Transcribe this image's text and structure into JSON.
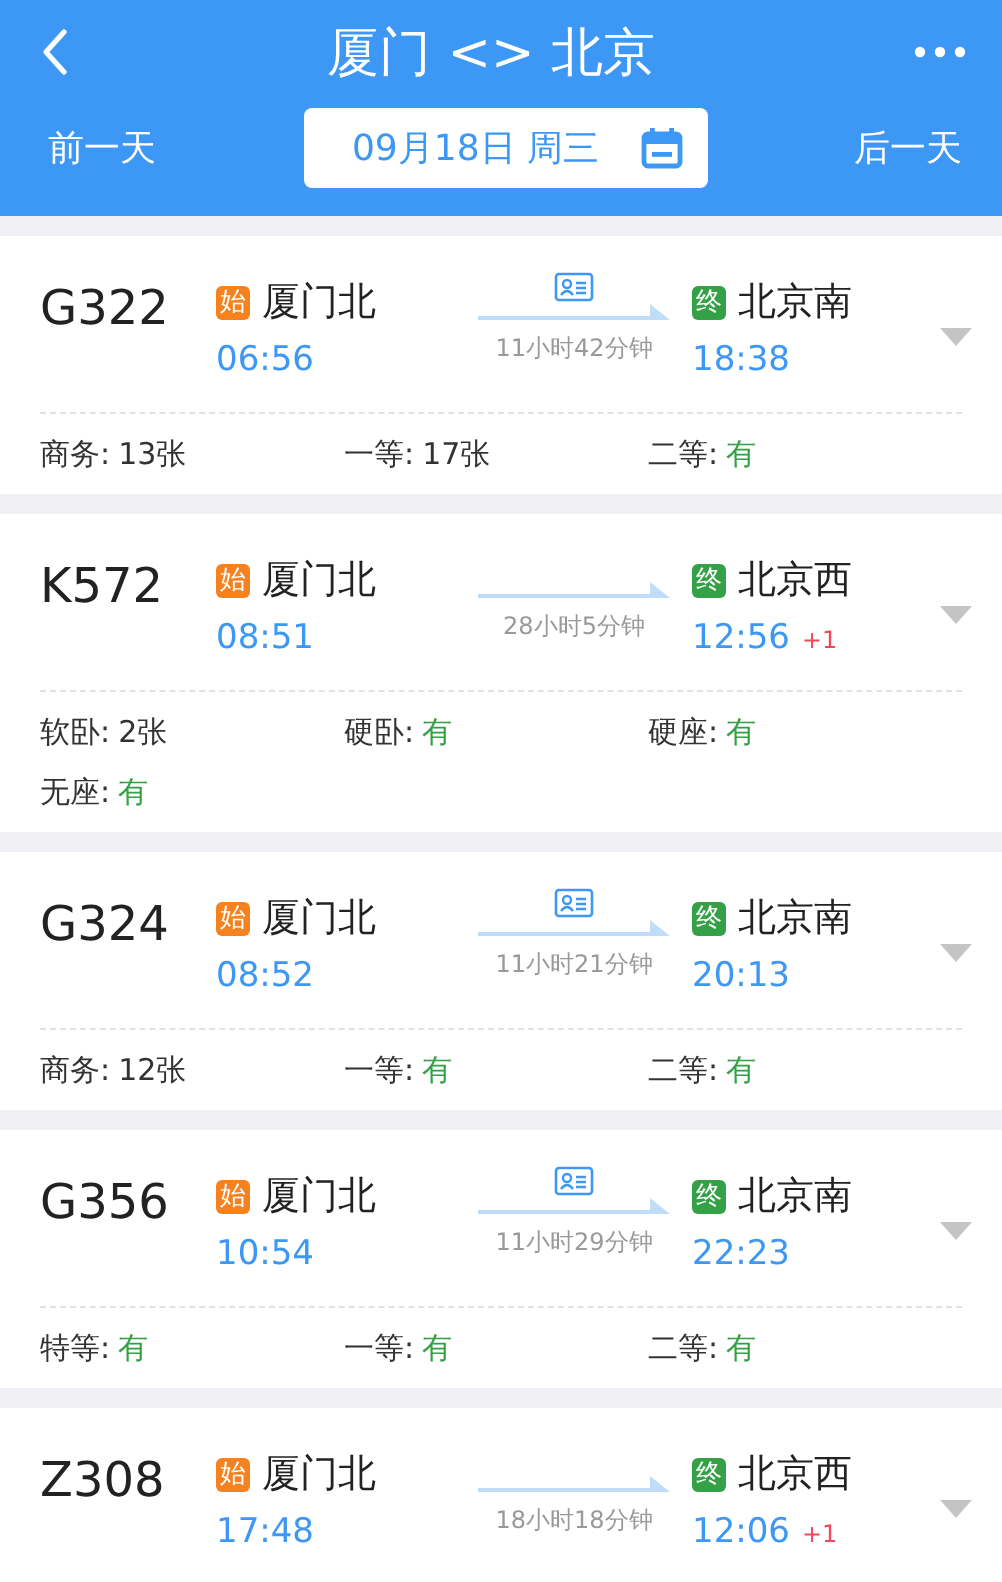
{
  "header": {
    "title": "厦门 <> 北京",
    "prev_day": "前一天",
    "date": "09月18日 周三",
    "next_day": "后一天"
  },
  "trains": [
    {
      "number": "G322",
      "from_badge": "始",
      "from": "厦门北",
      "depart": "06:56",
      "id_card": true,
      "duration": "11小时42分钟",
      "to_badge": "终",
      "to": "北京南",
      "arrive": "18:38",
      "seats": [
        {
          "label": "商务:",
          "value": "13张",
          "available": false
        },
        {
          "label": "一等:",
          "value": "17张",
          "available": false
        },
        {
          "label": "二等:",
          "value": "有",
          "available": true
        }
      ]
    },
    {
      "number": "K572",
      "from_badge": "始",
      "from": "厦门北",
      "depart": "08:51",
      "id_card": false,
      "duration": "28小时5分钟",
      "to_badge": "终",
      "to": "北京西",
      "arrive": "12:56",
      "day_offset": "+1",
      "seats": [
        {
          "label": "软卧:",
          "value": "2张",
          "available": false
        },
        {
          "label": "硬卧:",
          "value": "有",
          "available": true
        },
        {
          "label": "硬座:",
          "value": "有",
          "available": true
        },
        {
          "label": "无座:",
          "value": "有",
          "available": true
        }
      ]
    },
    {
      "number": "G324",
      "from_badge": "始",
      "from": "厦门北",
      "depart": "08:52",
      "id_card": true,
      "duration": "11小时21分钟",
      "to_badge": "终",
      "to": "北京南",
      "arrive": "20:13",
      "seats": [
        {
          "label": "商务:",
          "value": "12张",
          "available": false
        },
        {
          "label": "一等:",
          "value": "有",
          "available": true
        },
        {
          "label": "二等:",
          "value": "有",
          "available": true
        }
      ]
    },
    {
      "number": "G356",
      "from_badge": "始",
      "from": "厦门北",
      "depart": "10:54",
      "id_card": true,
      "duration": "11小时29分钟",
      "to_badge": "终",
      "to": "北京南",
      "arrive": "22:23",
      "seats": [
        {
          "label": "特等:",
          "value": "有",
          "available": true
        },
        {
          "label": "一等:",
          "value": "有",
          "available": true
        },
        {
          "label": "二等:",
          "value": "有",
          "available": true
        }
      ]
    },
    {
      "number": "Z308",
      "from_badge": "始",
      "from": "厦门北",
      "depart": "17:48",
      "id_card": false,
      "duration": "18小时18分钟",
      "to_badge": "终",
      "to": "北京西",
      "arrive": "12:06",
      "day_offset": "+1"
    }
  ]
}
